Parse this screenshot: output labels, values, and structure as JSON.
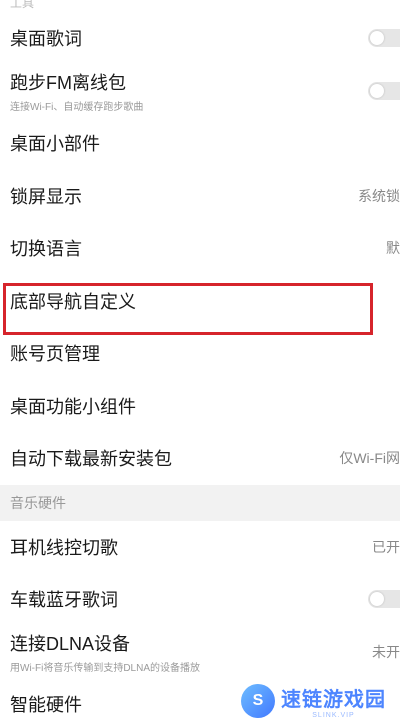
{
  "section_top_title": "工具",
  "tools": {
    "desktop_lyrics": "桌面歌词",
    "running_fm": {
      "label": "跑步FM离线包",
      "sub": "连接Wi-Fi、自动缓存跑步歌曲"
    },
    "desktop_widget": "桌面小部件",
    "lockscreen": {
      "label": "锁屏显示",
      "value": "系统锁"
    },
    "language": {
      "label": "切换语言",
      "value": "默"
    },
    "bottom_nav": "底部导航自定义",
    "account_page": "账号页管理",
    "desktop_func_widget": "桌面功能小组件",
    "auto_download": {
      "label": "自动下载最新安装包",
      "value": "仅Wi-Fi网"
    }
  },
  "section_hardware": "音乐硬件",
  "hardware": {
    "headset": {
      "label": "耳机线控切歌",
      "value": "已开"
    },
    "car_bt": "车载蓝牙歌词",
    "dlna": {
      "label": "连接DLNA设备",
      "sub": "用Wi-Fi将音乐传输到支持DLNA的设备播放",
      "value": "未开"
    },
    "smart": "智能硬件"
  },
  "watermark": {
    "title": "速链游戏园",
    "url": "SLINK.VIP",
    "logo_char": "S"
  },
  "colors": {
    "highlight": "#d6242b",
    "toggle_off": "#e6e6e6"
  }
}
